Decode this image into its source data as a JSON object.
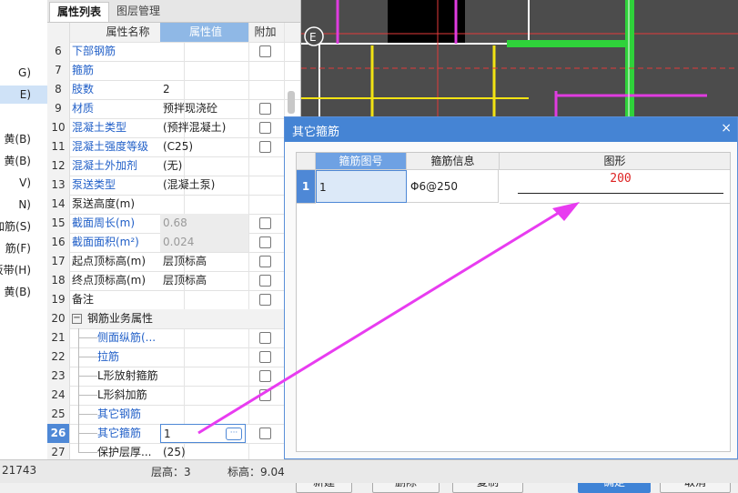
{
  "left_strip": {
    "items": [
      {
        "label": "G)",
        "selected": false
      },
      {
        "label": "E)",
        "selected": true
      },
      {
        "label": "黄(B)",
        "selected": false
      },
      {
        "label": "黄(B)",
        "selected": false
      },
      {
        "label": "V)",
        "selected": false
      },
      {
        "label": "N)",
        "selected": false
      },
      {
        "label": "加筋(S)",
        "selected": false
      },
      {
        "label": "筋(F)",
        "selected": false
      },
      {
        "label": "板带(H)",
        "selected": false
      },
      {
        "label": "黄(B)",
        "selected": false
      }
    ]
  },
  "property_panel": {
    "tabs": {
      "active": "属性列表",
      "inactive": "图层管理"
    },
    "columns": {
      "name": "属性名称",
      "value": "属性值",
      "add": "附加"
    },
    "rows": [
      {
        "num": "6",
        "name": "下部钢筋",
        "value": "",
        "checkbox": true,
        "name_style": "blue"
      },
      {
        "num": "7",
        "name": "箍筋",
        "value": "",
        "checkbox": false,
        "name_style": "blue"
      },
      {
        "num": "8",
        "name": "肢数",
        "value": "2",
        "checkbox": false,
        "name_style": "blue"
      },
      {
        "num": "9",
        "name": "材质",
        "value": "预拌现浇砼",
        "checkbox": true,
        "name_style": "blue"
      },
      {
        "num": "10",
        "name": "混凝土类型",
        "value": "(预拌混凝土)",
        "checkbox": true,
        "name_style": "blue"
      },
      {
        "num": "11",
        "name": "混凝土强度等级",
        "value": "(C25)",
        "checkbox": true,
        "name_style": "blue"
      },
      {
        "num": "12",
        "name": "混凝土外加剂",
        "value": "(无)",
        "checkbox": false,
        "name_style": "blue"
      },
      {
        "num": "13",
        "name": "泵送类型",
        "value": "(混凝土泵)",
        "checkbox": false,
        "name_style": "blue"
      },
      {
        "num": "14",
        "name": "泵送高度(m)",
        "value": "",
        "checkbox": false,
        "name_style": "normal"
      },
      {
        "num": "15",
        "name": "截面周长(m)",
        "value": "0.68",
        "checkbox": true,
        "name_style": "blue",
        "value_gray": true
      },
      {
        "num": "16",
        "name": "截面面积(m²)",
        "value": "0.024",
        "checkbox": true,
        "name_style": "blue",
        "value_gray": true
      },
      {
        "num": "17",
        "name": "起点顶标高(m)",
        "value": "层顶标高",
        "checkbox": true,
        "name_style": "normal"
      },
      {
        "num": "18",
        "name": "终点顶标高(m)",
        "value": "层顶标高",
        "checkbox": true,
        "name_style": "normal"
      },
      {
        "num": "19",
        "name": "备注",
        "value": "",
        "checkbox": true,
        "name_style": "normal"
      },
      {
        "num": "20",
        "name": "钢筋业务属性",
        "value": "",
        "checkbox": false,
        "name_style": "group"
      },
      {
        "num": "21",
        "name": "侧面纵筋(...",
        "value": "",
        "checkbox": true,
        "name_style": "blue-indent"
      },
      {
        "num": "22",
        "name": "拉筋",
        "value": "",
        "checkbox": true,
        "name_style": "blue-indent"
      },
      {
        "num": "23",
        "name": "L形放射箍筋",
        "value": "",
        "checkbox": true,
        "name_style": "normal-indent"
      },
      {
        "num": "24",
        "name": "L形斜加筋",
        "value": "",
        "checkbox": true,
        "name_style": "normal-indent"
      },
      {
        "num": "25",
        "name": "其它钢筋",
        "value": "",
        "checkbox": false,
        "name_style": "blue-indent"
      },
      {
        "num": "26",
        "name": "其它箍筋",
        "value": "1",
        "checkbox": true,
        "name_style": "blue-indent",
        "selected": true
      },
      {
        "num": "27",
        "name": "保护层厚...",
        "value": "(25)",
        "checkbox": false,
        "name_style": "normal-indent"
      }
    ],
    "dots_label": "···"
  },
  "status_bar": {
    "coord": "21743",
    "floor_height": "层高：3",
    "elevation": "标高：9.04"
  },
  "dialog": {
    "title": "其它箍筋",
    "close": "×",
    "grid": {
      "headers": {
        "code": "箍筋图号",
        "info": "箍筋信息",
        "shape": "图形"
      },
      "rows": [
        {
          "num": "1",
          "code": "1",
          "info": "Φ6@250",
          "shape_value": "200"
        }
      ]
    },
    "buttons": {
      "new": "新建",
      "delete": "删除",
      "copy": "复制",
      "ok": "确定",
      "cancel": "取消"
    }
  },
  "colors": {
    "accent": "#4584d4",
    "annotation_arrow": "#e83cf0",
    "shape_value": "#dd2222"
  }
}
